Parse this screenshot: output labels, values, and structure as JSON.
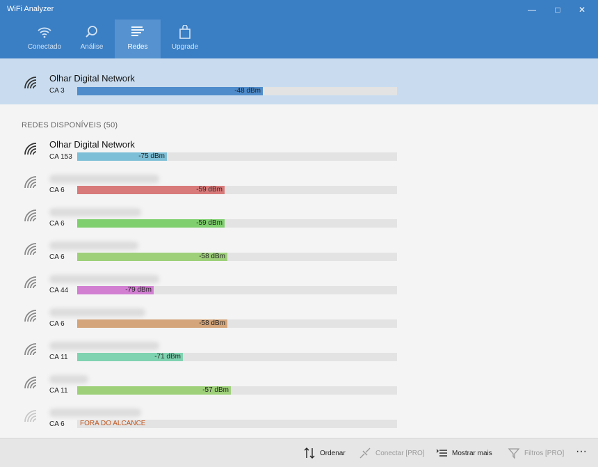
{
  "window": {
    "title": "WiFi Analyzer"
  },
  "tabs": [
    {
      "label": "Conectado",
      "icon": "wifi-icon"
    },
    {
      "label": "Análise",
      "icon": "magnifier-icon"
    },
    {
      "label": "Redes",
      "icon": "list-icon"
    },
    {
      "label": "Upgrade",
      "icon": "shopping-bag-icon"
    }
  ],
  "active_tab": "Redes",
  "connected": {
    "name": "Olhar Digital Network",
    "channel": "CA 3",
    "signal": "-48 dBm",
    "level": 0.58,
    "color": "#4f8ccb"
  },
  "available": {
    "label": "REDES DISPONÍVEIS (50)",
    "networks": [
      {
        "name": "Olhar Digital Network",
        "channel": "CA 153",
        "signal": "-75 dBm",
        "level": 0.28,
        "color": "#7dbfd6"
      },
      {
        "name": "",
        "channel": "CA 6",
        "signal": "-59 dBm",
        "level": 0.46,
        "color": "#d97a7a"
      },
      {
        "name": "",
        "channel": "CA 6",
        "signal": "-59 dBm",
        "level": 0.46,
        "color": "#7fcf6e"
      },
      {
        "name": "",
        "channel": "CA 6",
        "signal": "-58 dBm",
        "level": 0.47,
        "color": "#9ed07a"
      },
      {
        "name": "",
        "channel": "CA 44",
        "signal": "-79 dBm",
        "level": 0.24,
        "color": "#d27fd2"
      },
      {
        "name": "",
        "channel": "CA 6",
        "signal": "-58 dBm",
        "level": 0.47,
        "color": "#d4a57a"
      },
      {
        "name": "",
        "channel": "CA 11",
        "signal": "-71 dBm",
        "level": 0.33,
        "color": "#7fd3b0"
      },
      {
        "name": "",
        "channel": "CA 11",
        "signal": "-57 dBm",
        "level": 0.48,
        "color": "#9ed07a"
      },
      {
        "name": "",
        "channel": "CA 6",
        "signal": "FORA DO ALCANCE",
        "level": 0,
        "color": "#c0561f"
      }
    ]
  },
  "commands": {
    "sort": "Ordenar",
    "connect": "Conectar [PRO]",
    "show_more": "Mostrar mais",
    "filters": "Filtros [PRO]",
    "more": "···"
  }
}
